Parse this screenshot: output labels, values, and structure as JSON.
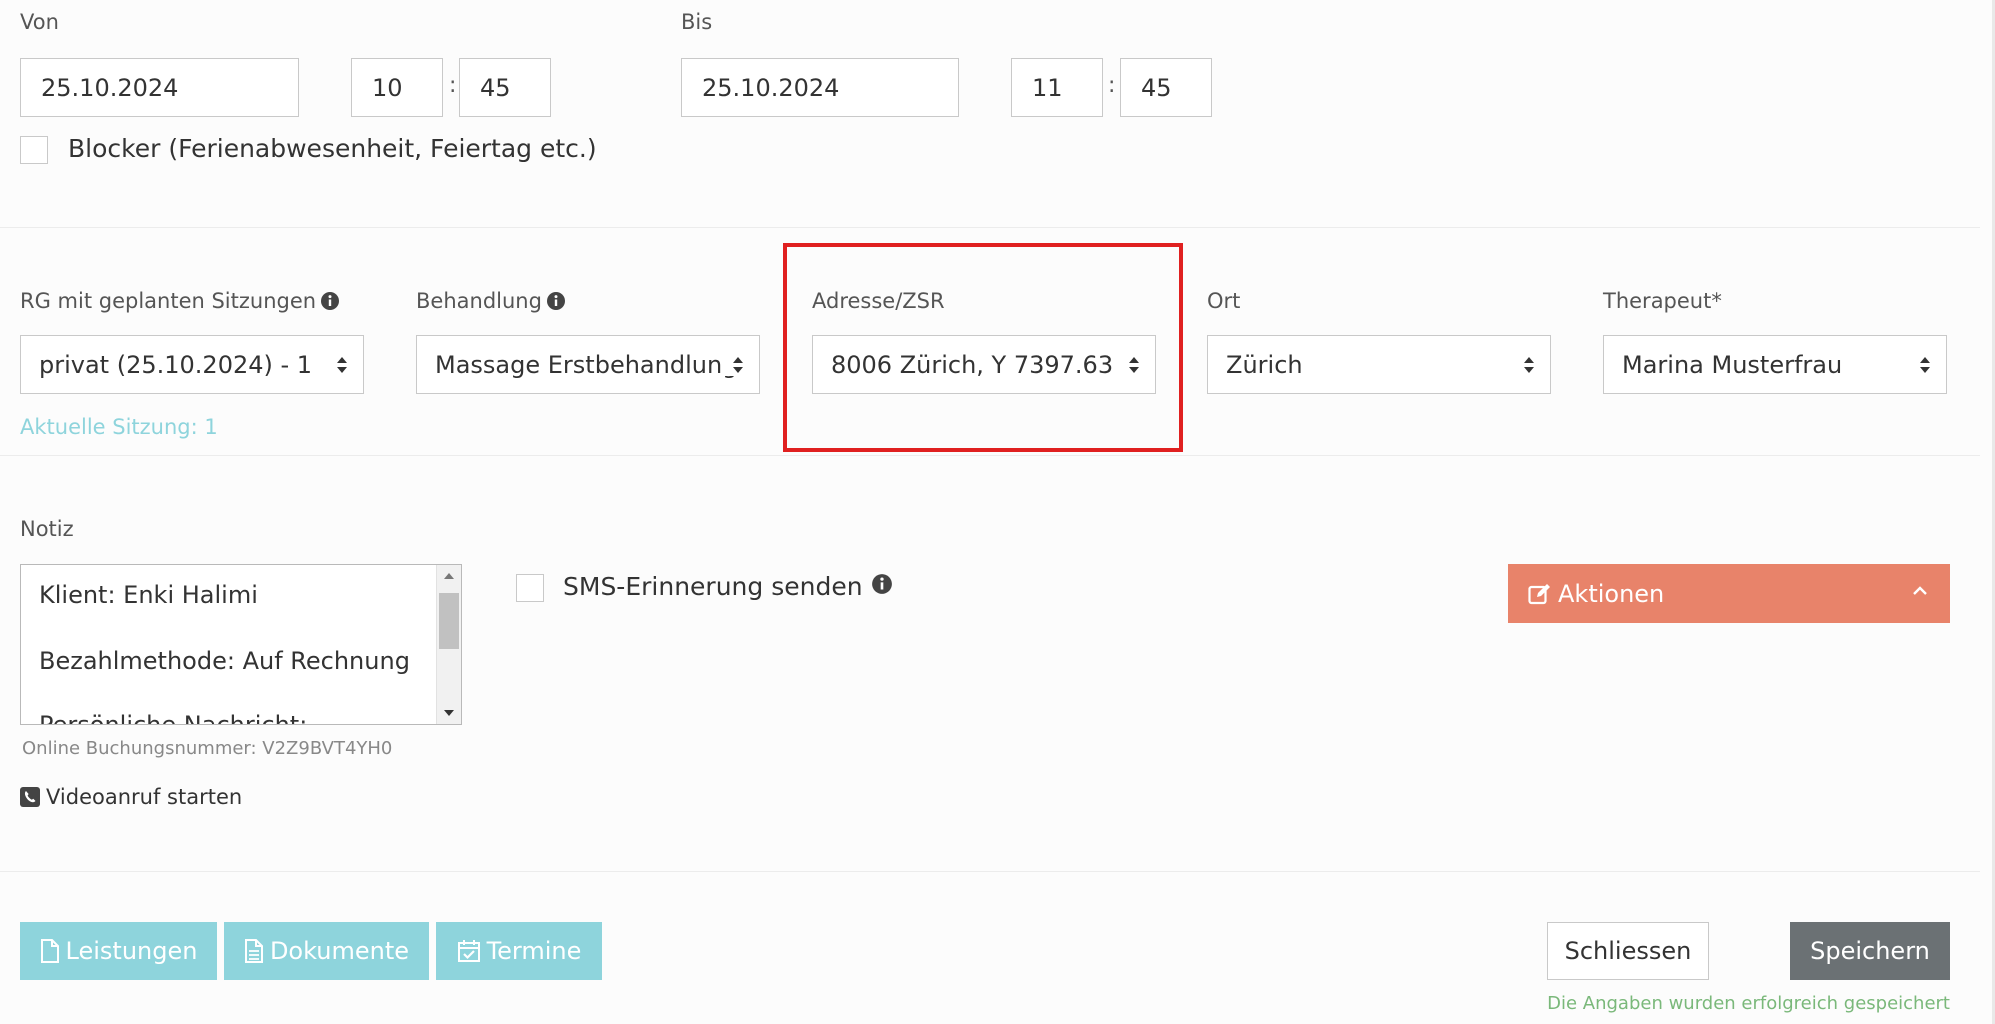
{
  "from": {
    "label": "Von",
    "date": "25.10.2024",
    "hour": "10",
    "minute": "45"
  },
  "to": {
    "label": "Bis",
    "date": "25.10.2024",
    "hour": "11",
    "minute": "45"
  },
  "time_separator": ":",
  "blocker": {
    "label": "Blocker (Ferienabwesenheit, Feiertag etc.)",
    "checked": false
  },
  "fields": {
    "rg": {
      "label": "RG mit geplanten Sitzungen",
      "value": "privat (25.10.2024) - 1"
    },
    "behandlung": {
      "label": "Behandlung",
      "value": "Massage Erstbehandlung"
    },
    "adresse": {
      "label": "Adresse/ZSR",
      "value": "8006 Zürich, Y 7397.63"
    },
    "ort": {
      "label": "Ort",
      "value": "Zürich"
    },
    "therapeut": {
      "label": "Therapeut*",
      "value": "Marina Musterfrau"
    }
  },
  "current_session": "Aktuelle Sitzung: 1",
  "notiz": {
    "label": "Notiz",
    "lines": [
      "Klient: Enki Halimi",
      "Bezahlmethode: Auf Rechnung",
      "Persönliche Nachricht:"
    ]
  },
  "booking_number": "Online Buchungsnummer: V2Z9BVT4YH0",
  "video_call": "Videoanruf starten",
  "sms": {
    "label": "SMS-Erinnerung senden",
    "checked": false
  },
  "actions_button": "Aktionen",
  "bottom_buttons": {
    "leistungen": "Leistungen",
    "dokumente": "Dokumente",
    "termine": "Termine",
    "close": "Schliessen",
    "save": "Speichern"
  },
  "status_message": "Die Angaben wurden erfolgreich gespeichert",
  "colors": {
    "accent_teal": "#8ed4dc",
    "actions_orange": "#e8836a",
    "save_gray": "#6b7174",
    "success_green": "#7ab87a",
    "highlight_red": "#e02020"
  }
}
